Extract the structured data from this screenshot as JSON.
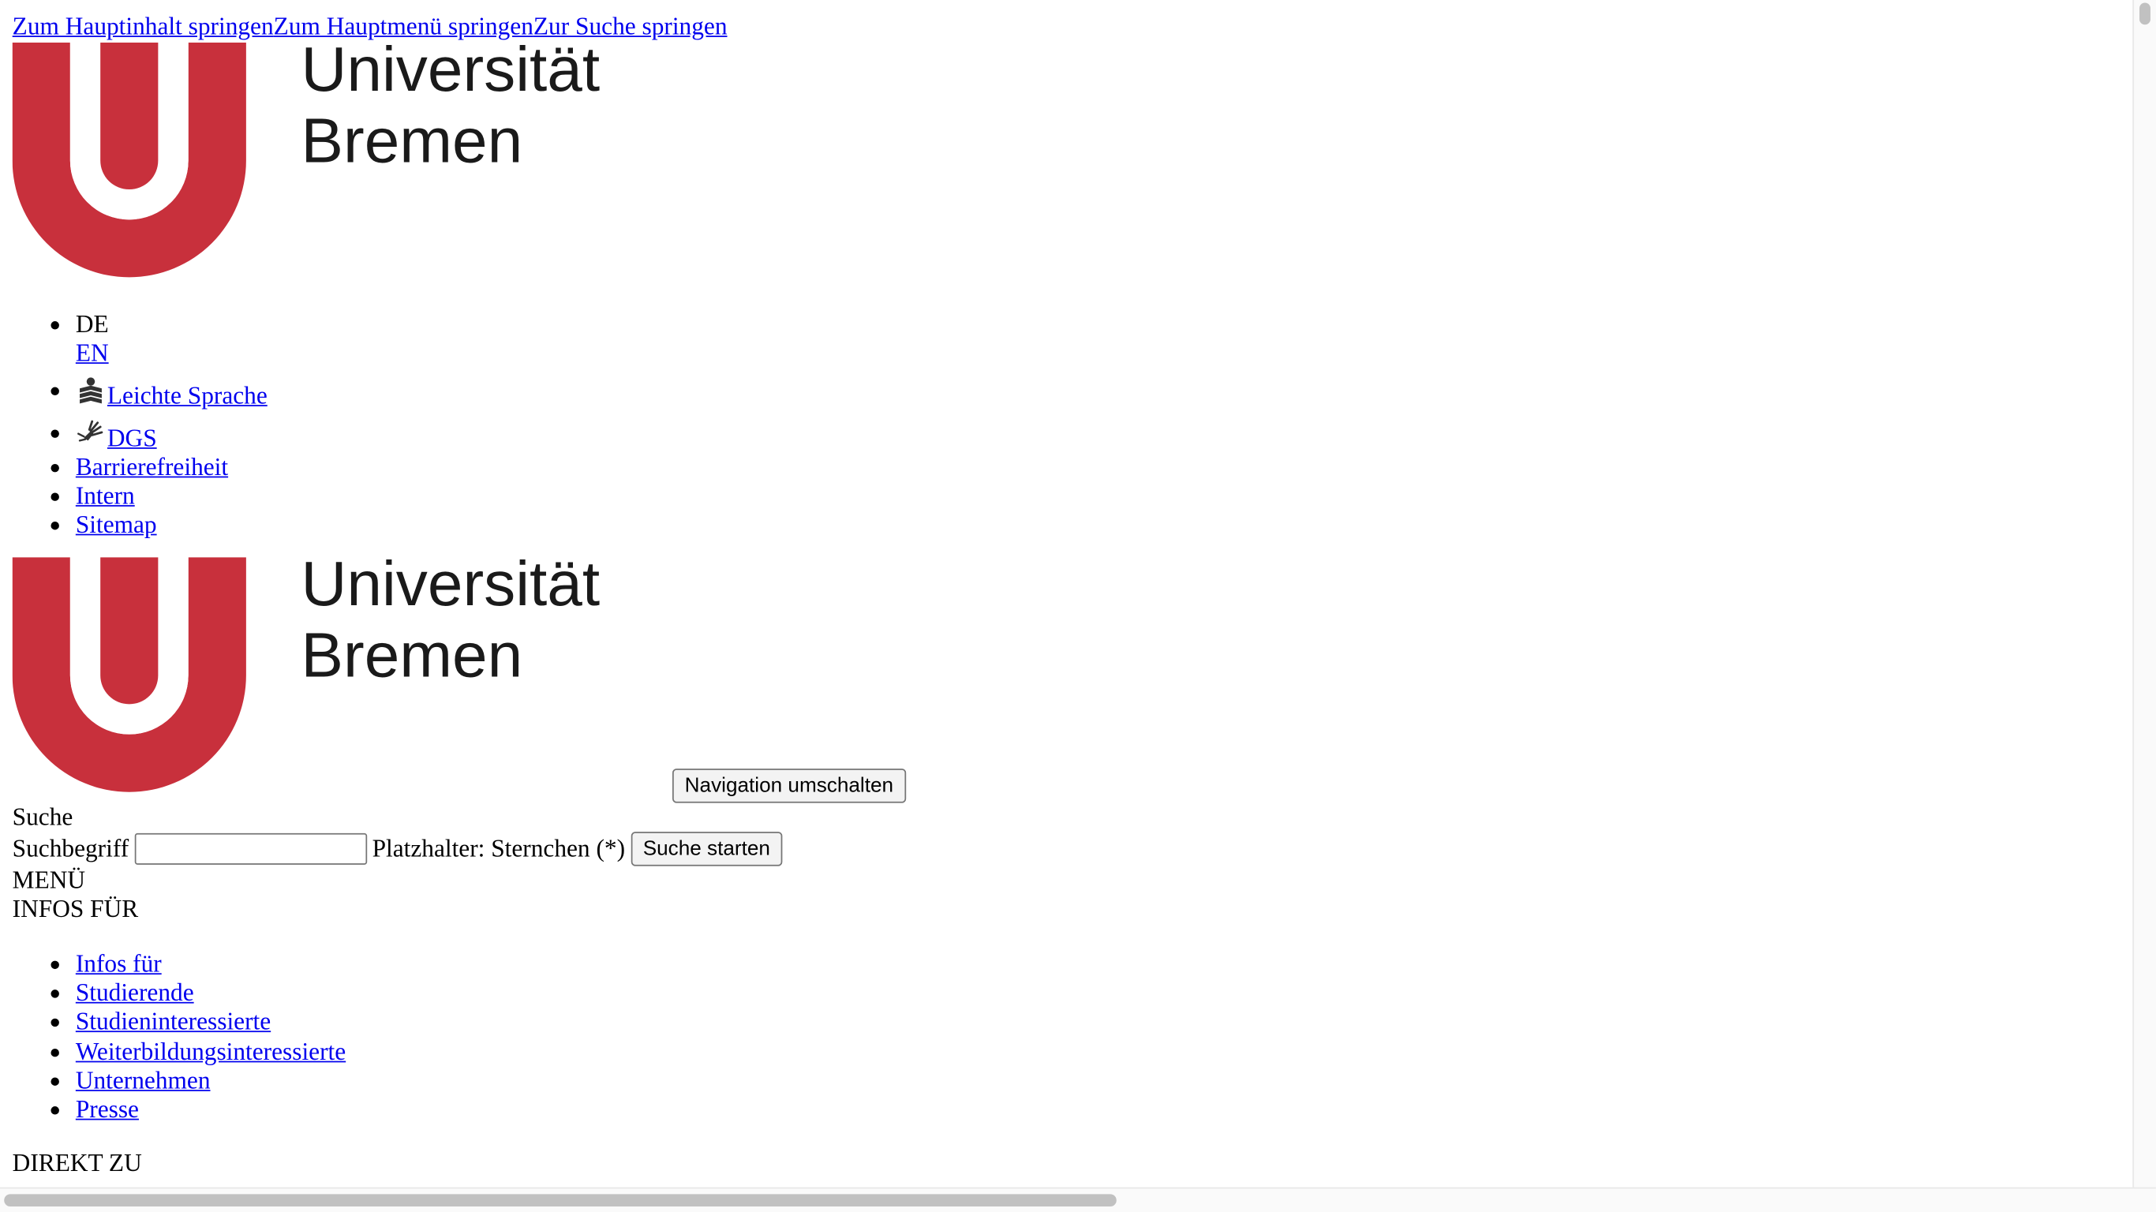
{
  "skip_links": [
    "Zum Hauptinhalt springen",
    "Zum Hauptmenü springen",
    "Zur Suche springen"
  ],
  "logo": {
    "line1": "Universität",
    "line2": "Bremen",
    "brand_red": "#c8303c",
    "text_color": "#1a1a1a"
  },
  "meta_nav": {
    "lang_current": "DE",
    "lang_alt": "EN",
    "easy_language": {
      "icon": "easy-language-icon",
      "label": "Leichte Sprache"
    },
    "sign_language": {
      "icon": "sign-language-icon",
      "label": "DGS"
    },
    "accessibility": "Barrierefreiheit",
    "intern": "Intern",
    "sitemap": "Sitemap"
  },
  "nav_toggle_label": "Navigation umschalten",
  "search": {
    "heading": "Suche",
    "field_label": "Suchbegriff",
    "value": "",
    "hint": "Platzhalter: Sternchen (*)",
    "submit_label": "Suche starten"
  },
  "menu_label": "MENÜ",
  "infos_heading": "INFOS FÜR",
  "infos_items": [
    "Infos für",
    "Studierende",
    "Studieninteressierte",
    "Weiterbildungsinteressierte",
    "Unternehmen",
    "Presse"
  ],
  "direkt_heading": "DIREKT ZU"
}
